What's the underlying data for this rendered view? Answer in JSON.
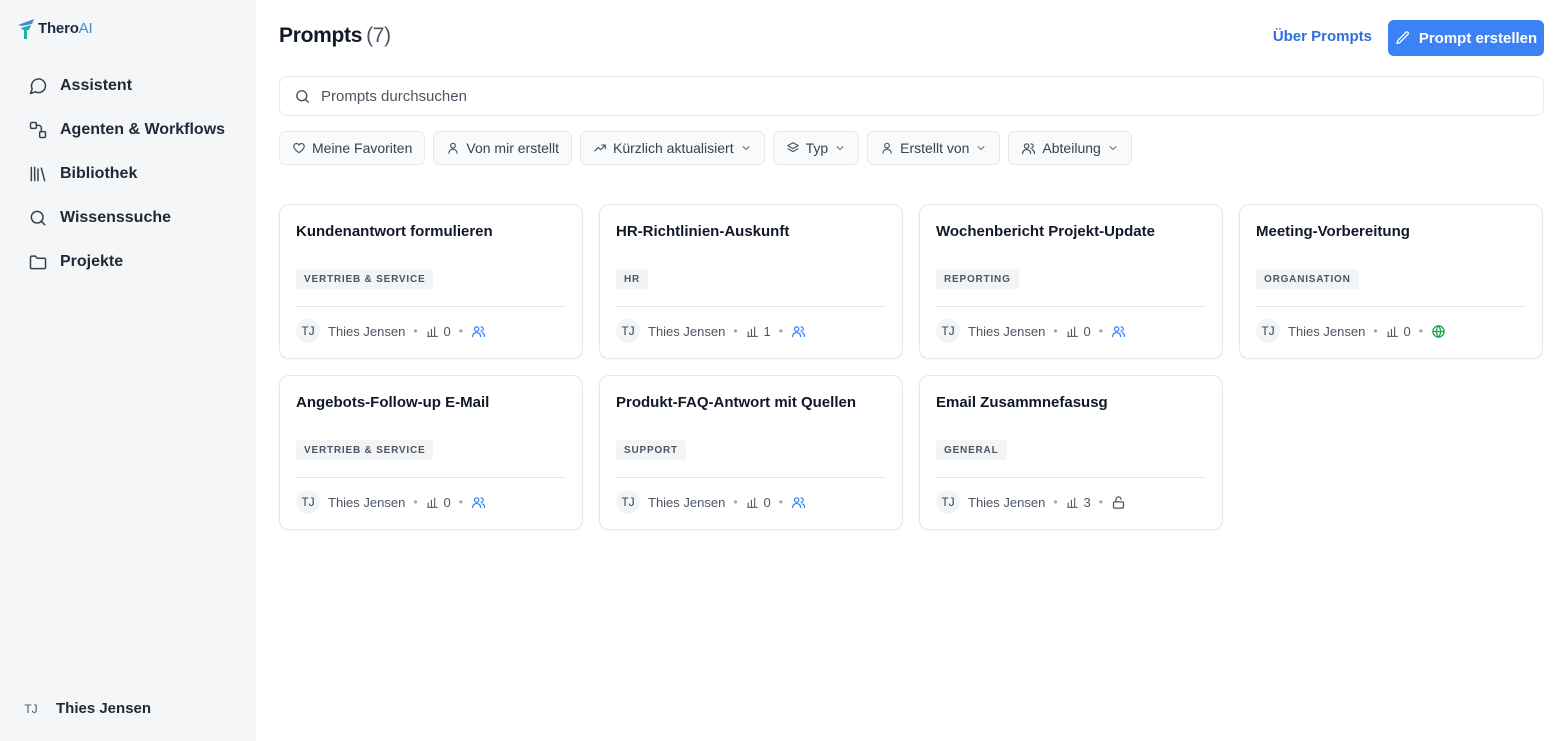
{
  "app": {
    "logo_main": "Thero",
    "logo_accent": "AI",
    "accent_color": "#3b82f6"
  },
  "sidebar": {
    "items": [
      {
        "label": "Assistent",
        "icon": "chat-bubble-icon"
      },
      {
        "label": "Agenten & Workflows",
        "icon": "workflow-icon"
      },
      {
        "label": "Bibliothek",
        "icon": "library-icon"
      },
      {
        "label": "Wissenssuche",
        "icon": "search-icon"
      },
      {
        "label": "Projekte",
        "icon": "folder-icon"
      }
    ],
    "user": {
      "initials": "TJ",
      "name": "Thies Jensen"
    }
  },
  "header": {
    "title": "Prompts",
    "count": "(7)",
    "about_label": "Über Prompts",
    "create_label": "Prompt erstellen"
  },
  "search": {
    "placeholder": "Prompts durchsuchen",
    "value": ""
  },
  "filters": [
    {
      "label": "Meine Favoriten",
      "icon": "heart-icon"
    },
    {
      "label": "Von mir erstellt",
      "icon": "user-icon"
    },
    {
      "label": "Kürzlich aktualisiert",
      "icon": "trending-icon",
      "dropdown": true
    },
    {
      "label": "Typ",
      "icon": "layers-icon",
      "dropdown": true
    },
    {
      "label": "Erstellt von",
      "icon": "user-icon",
      "dropdown": true
    },
    {
      "label": "Abteilung",
      "icon": "users-icon",
      "dropdown": true
    }
  ],
  "prompts": [
    {
      "title": "Kundenantwort formulieren",
      "tag": "VERTRIEB & SERVICE",
      "initials": "TJ",
      "author": "Thies Jensen",
      "uses": "0",
      "visibility": "team-icon"
    },
    {
      "title": "HR-Richtlinien-Auskunft",
      "tag": "HR",
      "initials": "TJ",
      "author": "Thies Jensen",
      "uses": "1",
      "visibility": "team-icon"
    },
    {
      "title": "Wochenbericht Projekt-Update",
      "tag": "REPORTING",
      "initials": "TJ",
      "author": "Thies Jensen",
      "uses": "0",
      "visibility": "team-icon"
    },
    {
      "title": "Meeting-Vorbereitung",
      "tag": "ORGANISATION",
      "initials": "TJ",
      "author": "Thies Jensen",
      "uses": "0",
      "visibility": "globe-icon"
    },
    {
      "title": "Angebots-Follow-up E-Mail",
      "tag": "VERTRIEB & SERVICE",
      "initials": "TJ",
      "author": "Thies Jensen",
      "uses": "0",
      "visibility": "team-icon"
    },
    {
      "title": "Produkt-FAQ-Antwort mit Quellen",
      "tag": "SUPPORT",
      "initials": "TJ",
      "author": "Thies Jensen",
      "uses": "0",
      "visibility": "team-icon"
    },
    {
      "title": "Email Zusammnefasusg",
      "tag": "GENERAL",
      "initials": "TJ",
      "author": "Thies Jensen",
      "uses": "3",
      "visibility": "lock-icon"
    }
  ]
}
